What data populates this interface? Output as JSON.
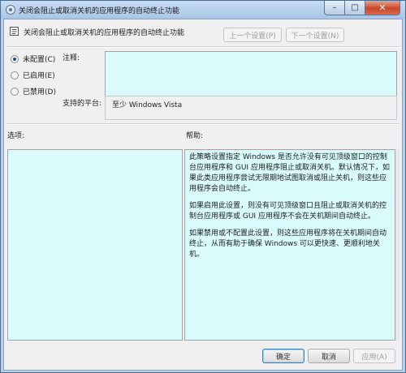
{
  "window": {
    "title": "关闭会阻止或取消关机的应用程序的自动终止功能"
  },
  "header": {
    "title": "关闭会阻止或取消关机的应用程序的自动终止功能",
    "prev_label": "上一个设置(P)",
    "next_label": "下一个设置(N)"
  },
  "state": {
    "options": [
      {
        "label": "未配置(C)",
        "checked": true
      },
      {
        "label": "已启用(E)",
        "checked": false
      },
      {
        "label": "已禁用(D)",
        "checked": false
      }
    ]
  },
  "comment": {
    "label": "注释:",
    "value": ""
  },
  "platform": {
    "label": "支持的平台:",
    "value": "至少 Windows Vista"
  },
  "options_section": {
    "label": "选项:"
  },
  "help_section": {
    "label": "帮助:",
    "paragraphs": [
      "此策略设置指定 Windows 是否允许没有可见顶级窗口的控制台应用程序和 GUI 应用程序阻止或取消关机。默认情况下，如果此类应用程序尝试无限期地试图取消或阻止关机，则这些应用程序会自动终止。",
      "如果启用此设置，则没有可见顶级窗口且阻止或取消关机的控制台应用程序或 GUI 应用程序不会在关机期间自动终止。",
      "如果禁用或不配置此设置，则这些应用程序将在关机期间自动终止，从而有助于确保 Windows 可以更快速、更顺利地关机。"
    ]
  },
  "footer": {
    "ok_label": "确定",
    "cancel_label": "取消",
    "apply_label": "应用(A)"
  },
  "colors": {
    "text_area_bg": "#d9fbfb",
    "dialog_bg": "#f0f0f0",
    "frame": "#b9d1ea",
    "close_button": "#c9472c"
  },
  "icons": {
    "title": "policy-setting-icon",
    "header": "policy-document-icon"
  }
}
